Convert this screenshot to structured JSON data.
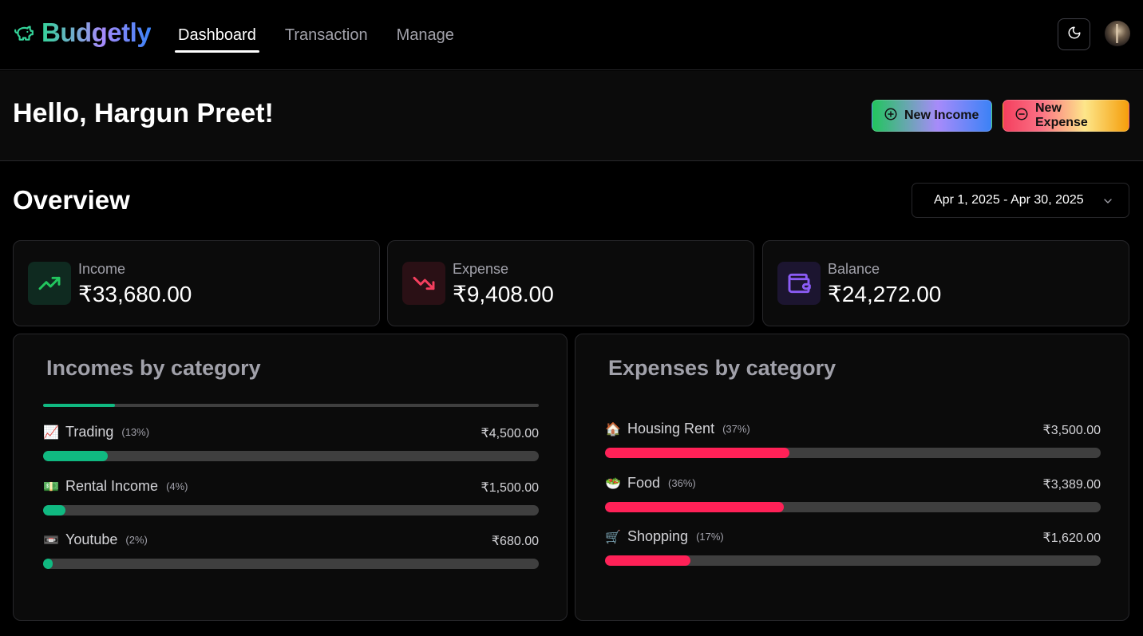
{
  "app": {
    "name": "Budgetly",
    "accent": "#34d399"
  },
  "nav": {
    "tabs": [
      {
        "label": "Dashboard",
        "active": true
      },
      {
        "label": "Transaction",
        "active": false
      },
      {
        "label": "Manage",
        "active": false
      }
    ],
    "theme_icon": "moon-icon"
  },
  "header": {
    "greeting": "Hello, Hargun Preet!",
    "new_income_label": "New Income",
    "new_expense_label": "New Expense"
  },
  "overview": {
    "title": "Overview",
    "date_range": "Apr 1, 2025 - Apr 30, 2025",
    "stats": [
      {
        "label": "Income",
        "value": "₹33,680.00",
        "icon": "trending-up-icon",
        "color": "#22c55e"
      },
      {
        "label": "Expense",
        "value": "₹9,408.00",
        "icon": "trending-down-icon",
        "color": "#f43f5e"
      },
      {
        "label": "Balance",
        "value": "₹24,272.00",
        "icon": "wallet-icon",
        "color": "#8b5cf6"
      }
    ]
  },
  "incomes": {
    "title": "Incomes by category",
    "bar_color": "#10b981",
    "items": [
      {
        "emoji": "📈",
        "name": "Trading",
        "pct": "(13%)",
        "amount": "₹4,500.00",
        "fraction": 0.13
      },
      {
        "emoji": "💵",
        "name": "Rental Income",
        "pct": "(4%)",
        "amount": "₹1,500.00",
        "fraction": 0.045
      },
      {
        "emoji": "📼",
        "name": "Youtube",
        "pct": "(2%)",
        "amount": "₹680.00",
        "fraction": 0.02
      }
    ]
  },
  "expenses": {
    "title": "Expenses by category",
    "bar_color": "#ff2157",
    "items": [
      {
        "emoji": "🏠",
        "name": "Housing Rent",
        "pct": "(37%)",
        "amount": "₹3,500.00",
        "fraction": 0.372
      },
      {
        "emoji": "🥗",
        "name": "Food",
        "pct": "(36%)",
        "amount": "₹3,389.00",
        "fraction": 0.36
      },
      {
        "emoji": "🛒",
        "name": "Shopping",
        "pct": "(17%)",
        "amount": "₹1,620.00",
        "fraction": 0.172
      }
    ]
  }
}
